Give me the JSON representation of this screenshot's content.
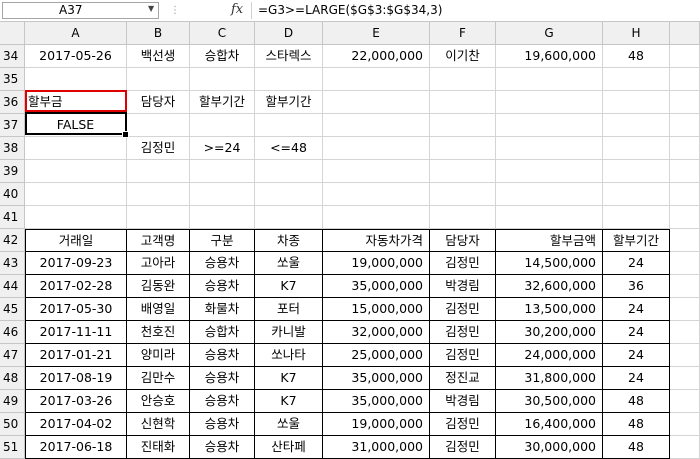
{
  "formula_bar": {
    "name_box": "A37",
    "fx_label": "fx",
    "formula": "=G3>=LARGE($G$3:$G$34,3)"
  },
  "columns": [
    "A",
    "B",
    "C",
    "D",
    "E",
    "F",
    "G",
    "H"
  ],
  "rows": {
    "r34": {
      "num": "34",
      "cells": [
        "2017-05-26",
        "백선생",
        "승합차",
        "스타렉스",
        "22,000,000",
        "이기찬",
        "19,600,000",
        "48"
      ]
    },
    "r35": {
      "num": "35"
    },
    "r36": {
      "num": "36",
      "cells": [
        "할부금",
        "담당자",
        "할부기간",
        "할부기간",
        "",
        "",
        "",
        ""
      ]
    },
    "r37": {
      "num": "37",
      "cells": [
        "FALSE",
        "",
        "",
        "",
        "",
        "",
        "",
        ""
      ]
    },
    "r38": {
      "num": "38",
      "cells": [
        "",
        "김정민",
        ">=24",
        "<=48",
        "",
        "",
        "",
        ""
      ]
    },
    "r39": {
      "num": "39"
    },
    "r40": {
      "num": "40"
    },
    "r41": {
      "num": "41"
    },
    "r42": {
      "num": "42",
      "cells": [
        "거래일",
        "고객명",
        "구분",
        "차종",
        "자동차가격",
        "담당자",
        "할부금액",
        "할부기간"
      ]
    },
    "r43": {
      "num": "43",
      "cells": [
        "2017-09-23",
        "고아라",
        "승용차",
        "쏘울",
        "19,000,000",
        "김정민",
        "14,500,000",
        "24"
      ]
    },
    "r44": {
      "num": "44",
      "cells": [
        "2017-02-28",
        "김동완",
        "승용차",
        "K7",
        "35,000,000",
        "박경림",
        "32,600,000",
        "36"
      ]
    },
    "r45": {
      "num": "45",
      "cells": [
        "2017-05-30",
        "배영일",
        "화물차",
        "포터",
        "15,000,000",
        "김정민",
        "13,500,000",
        "24"
      ]
    },
    "r46": {
      "num": "46",
      "cells": [
        "2017-11-11",
        "천호진",
        "승합차",
        "카니발",
        "32,000,000",
        "김정민",
        "30,200,000",
        "24"
      ]
    },
    "r47": {
      "num": "47",
      "cells": [
        "2017-01-21",
        "양미라",
        "승용차",
        "쏘나타",
        "25,000,000",
        "김정민",
        "24,000,000",
        "24"
      ]
    },
    "r48": {
      "num": "48",
      "cells": [
        "2017-08-19",
        "김만수",
        "승용차",
        "K7",
        "35,000,000",
        "정진교",
        "31,800,000",
        "24"
      ]
    },
    "r49": {
      "num": "49",
      "cells": [
        "2017-03-26",
        "안승호",
        "승용차",
        "K7",
        "35,000,000",
        "박경림",
        "30,500,000",
        "48"
      ]
    },
    "r50": {
      "num": "50",
      "cells": [
        "2017-04-02",
        "신현학",
        "승용차",
        "쏘울",
        "19,000,000",
        "김정민",
        "16,400,000",
        "48"
      ]
    },
    "r51": {
      "num": "51",
      "cells": [
        "2017-06-18",
        "진태화",
        "승용차",
        "산타페",
        "31,000,000",
        "김정민",
        "30,000,000",
        "48"
      ]
    }
  }
}
